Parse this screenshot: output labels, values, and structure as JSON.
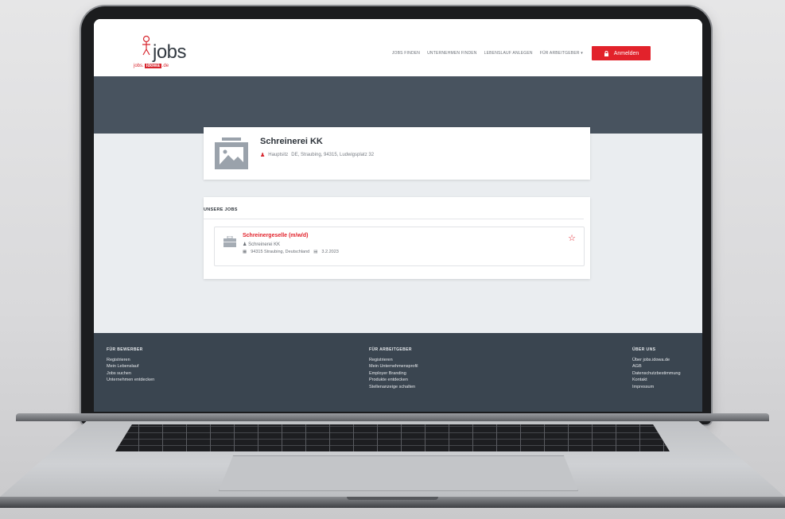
{
  "header": {
    "logo_text": "jobs",
    "logo_sub_pre": "jobs.",
    "logo_sub_brand": "idowa",
    "logo_sub_post": ".de",
    "nav": [
      "JOBS FINDEN",
      "UNTERNEHMEN FINDEN",
      "LEBENSLAUF ANLEGEN",
      "FÜR ARBEITGEBER ▾"
    ],
    "login_label": "Anmelden"
  },
  "company": {
    "name": "Schreinerei KK",
    "location_type": "Hauptsitz",
    "address": "DE, Straubing, 94315, Ludwigsplatz 32"
  },
  "jobs": {
    "section_title": "UNSERE JOBS",
    "items": [
      {
        "title": "Schreinergeselle (m/w/d)",
        "company": "Schreinerei KK",
        "location": "94315 Straubing, Deutschland",
        "date": "3.2.2023"
      }
    ]
  },
  "footer": {
    "col1": {
      "heading": "FÜR BEWERBER",
      "links": [
        "Registrieren",
        "Mein Lebenslauf",
        "Jobs suchen",
        "Unternehmen entdecken"
      ]
    },
    "col2": {
      "heading": "FÜR ARBEITGEBER",
      "links": [
        "Registrieren",
        "Mein Unternehmensprofil",
        "Employer Branding",
        "Produkte entdecken",
        "Stellenanzeige schalten"
      ]
    },
    "col3": {
      "heading": "ÜBER UNS",
      "links": [
        "Über jobs.idowa.de",
        "AGB",
        "Datenschutzbestimmung",
        "Kontakt",
        "Impressum"
      ]
    }
  },
  "colors": {
    "accent": "#e2222b",
    "banner": "#48535f",
    "footer": "#3a4550"
  },
  "icons": [
    "pin-icon",
    "briefcase-icon",
    "star-icon",
    "user-icon",
    "location-icon",
    "calendar-icon",
    "image-placeholder-icon",
    "login-icon"
  ]
}
